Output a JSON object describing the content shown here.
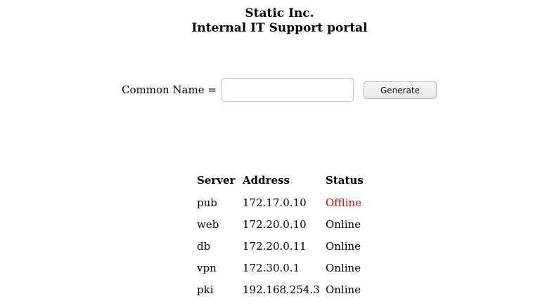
{
  "header": {
    "company": "Static Inc.",
    "portal_title": "Internal IT Support portal"
  },
  "form": {
    "common_name_label": "Common Name =",
    "common_name_value": "",
    "generate_label": "Generate"
  },
  "table": {
    "headers": [
      "Server",
      "Address",
      "Status"
    ],
    "rows": [
      {
        "server": "pub",
        "address": "172.17.0.10",
        "status": "Offline"
      },
      {
        "server": "web",
        "address": "172.20.0.10",
        "status": "Online"
      },
      {
        "server": "db",
        "address": "172.20.0.11",
        "status": "Online"
      },
      {
        "server": "vpn",
        "address": "172.30.0.1",
        "status": "Online"
      },
      {
        "server": "pki",
        "address": "192.168.254.3",
        "status": "Online"
      }
    ]
  },
  "colors": {
    "offline": "#dd0000",
    "online": "#000000"
  }
}
